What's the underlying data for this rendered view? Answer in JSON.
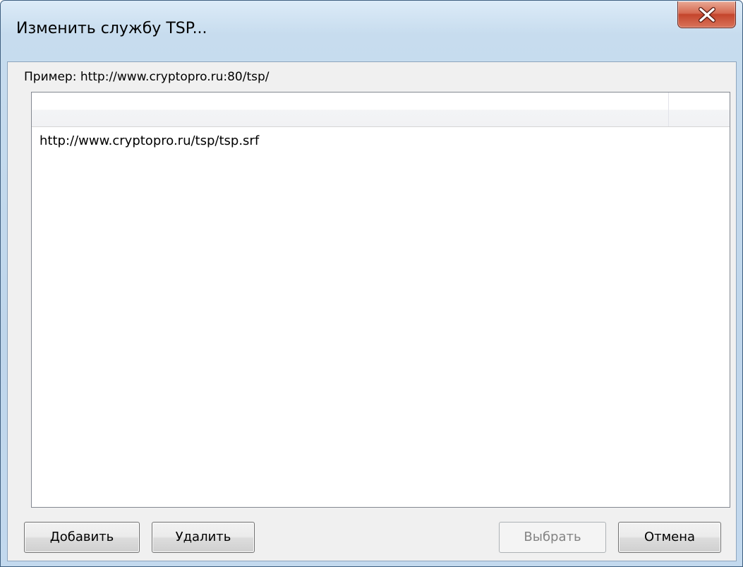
{
  "window": {
    "title": "Изменить службу TSP..."
  },
  "hint": {
    "text": "Пример: http://www.cryptopro.ru:80/tsp/"
  },
  "list": {
    "columns": [
      "",
      ""
    ],
    "rows": [
      "http://www.cryptopro.ru/tsp/tsp.srf"
    ]
  },
  "buttons": {
    "add_label": "Добавить",
    "delete_label": "Удалить",
    "select_label": "Выбрать",
    "select_enabled": false,
    "cancel_label": "Отмена"
  },
  "icons": {
    "close": "close-icon"
  },
  "colors": {
    "title_bar": "#c3d9ee",
    "close_button": "#c4452c",
    "client_background": "#f0f0f0",
    "list_background": "#ffffff",
    "disabled_text": "#838383"
  }
}
